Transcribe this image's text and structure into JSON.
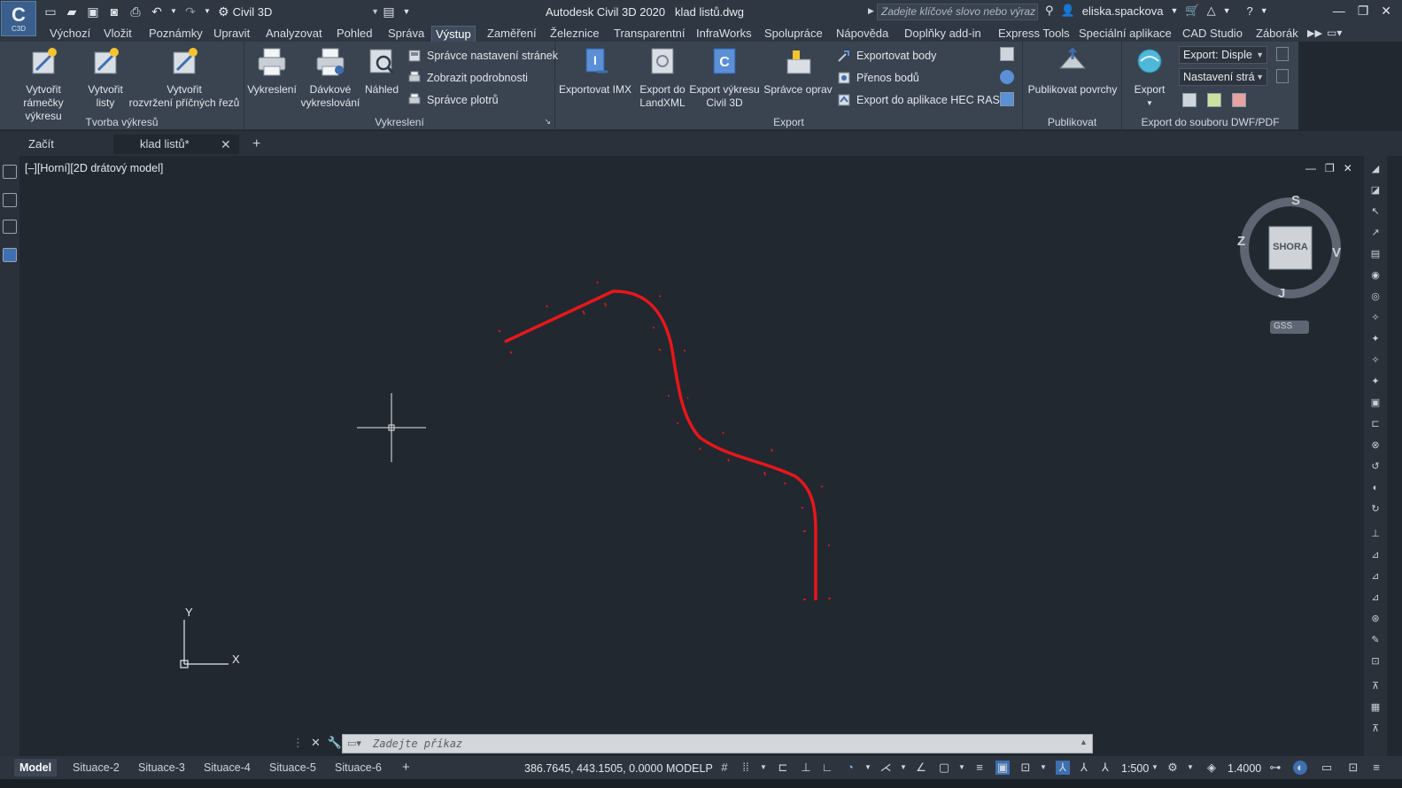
{
  "app": {
    "logo_text": "C",
    "logo_sub": "C3D",
    "workspace": "Civil 3D",
    "title": "Autodesk Civil 3D 2020",
    "filename": "klad listů.dwg",
    "search_placeholder": "Zadejte klíčové slovo nebo výraz",
    "user": "eliska.spackova"
  },
  "ribbon_tabs": [
    "Výchozí",
    "Vložit",
    "Poznámky",
    "Upravit",
    "Analyzovat",
    "Pohled",
    "Správa",
    "Výstup",
    "Zaměření",
    "Železnice",
    "Transparentní",
    "InfraWorks",
    "Spolupráce",
    "Nápověda",
    "Doplňky add-in",
    "Express Tools",
    "Speciální aplikace",
    "CAD Studio",
    "Záborák"
  ],
  "active_tab": "Výstup",
  "ribbon": {
    "tvorba": {
      "title": "Tvorba výkresů",
      "btn1": [
        "Vytvořit",
        "rámečky výkresu"
      ],
      "btn2": [
        "Vytvořit",
        "listy"
      ],
      "btn3": [
        "Vytvořit",
        "rozvržení příčných řezů"
      ]
    },
    "vykresleni": {
      "title": "Vykreslení",
      "plot": "Vykreslení",
      "batch": [
        "Dávkové",
        "vykreslování"
      ],
      "preview": "Náhled",
      "page_setup": "Správce nastavení stránek",
      "details": "Zobrazit podrobnosti",
      "plotter": "Správce plotrů"
    },
    "export": {
      "title": "Export",
      "imx": "Exportovat IMX",
      "landxml": [
        "Export do",
        "LandXML"
      ],
      "civil": [
        "Export výkresu",
        "Civil 3D"
      ],
      "corrections": "Správce oprav",
      "points": "Exportovat body",
      "transfer": "Přenos bodů",
      "hecras": "Export do aplikace HEC RAS"
    },
    "publikovat": {
      "title": "Publikovat",
      "surfaces": "Publikovat povrchy"
    },
    "dwf": {
      "title": "Export do souboru DWF/PDF",
      "export": "Export",
      "combo1": "Export: Disple",
      "combo2": "Nastavení strá"
    }
  },
  "doc_tabs": {
    "start": "Začít",
    "active": "klad listů*"
  },
  "viewport": {
    "label": "[–][Horní][2D drátový model]",
    "viewcube_face": "SHORA",
    "north": "S",
    "south": "J",
    "west": "Z",
    "east": "V",
    "wcs": "GSS",
    "ucs_x": "X",
    "ucs_y": "Y"
  },
  "command": {
    "placeholder": "Zadejte příkaz"
  },
  "status": {
    "layouts": [
      "Model",
      "Situace-2",
      "Situace-3",
      "Situace-4",
      "Situace-5",
      "Situace-6"
    ],
    "coords": "386.7645, 443.1505, 0.0000",
    "space": "MODELP",
    "scale": "1:500",
    "lineweight": "1.4000"
  },
  "colors": {
    "alignment": "#e8161a",
    "background": "#212830",
    "ribbon": "#3a4350"
  }
}
